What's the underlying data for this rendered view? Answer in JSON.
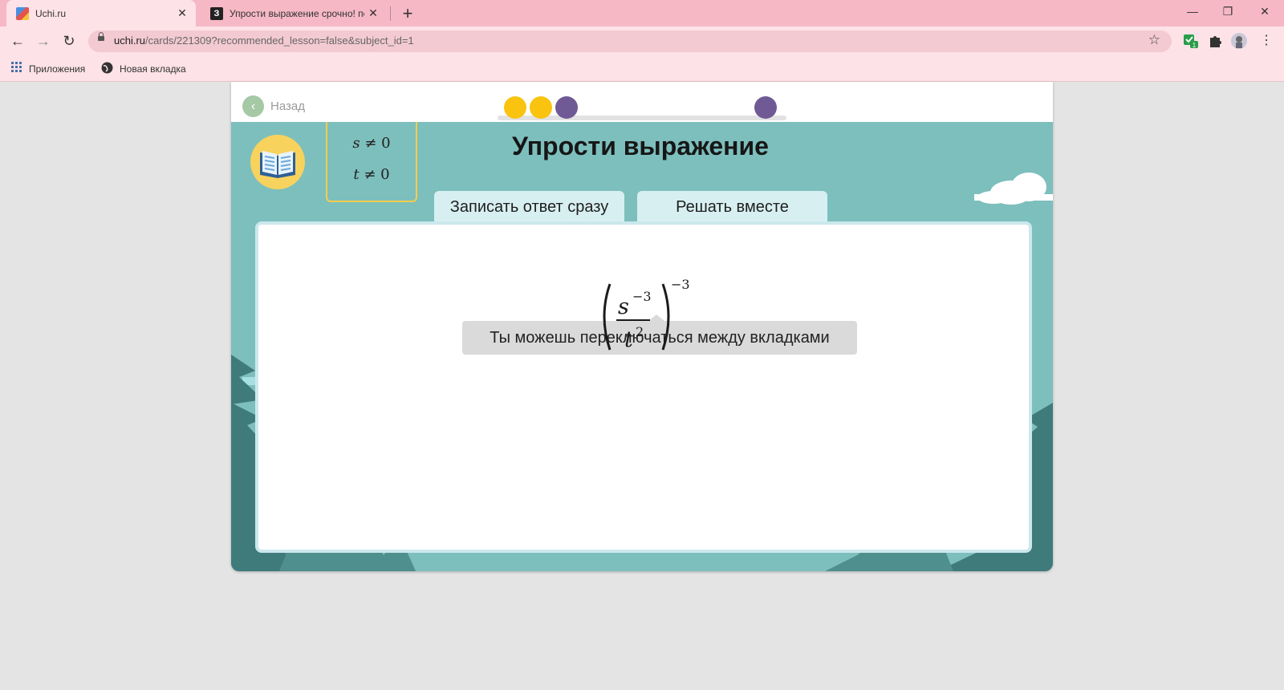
{
  "browser": {
    "tabs": [
      {
        "title": "Uchi.ru",
        "active": true
      },
      {
        "title": "Упрости выражение срочно! пс",
        "active": false
      }
    ],
    "url_host": "uchi.ru",
    "url_path": "/cards/221309?recommended_lesson=false&subject_id=1",
    "bookmarks": [
      {
        "label": "Приложения",
        "icon": "apps-grid-icon"
      },
      {
        "label": "Новая вкладка",
        "icon": "globe-icon"
      }
    ],
    "extension_badge": "1",
    "colors": {
      "tabbar": "#f7b8c6",
      "toolbar": "#fde2e7"
    }
  },
  "page": {
    "back_label": "Назад",
    "progress": {
      "steps": [
        "done",
        "done",
        "current",
        "current"
      ],
      "colors": {
        "done": "#f9c310",
        "current": "#6f5a96"
      }
    },
    "title": "Упрости выражение",
    "conditions": [
      {
        "var": "s",
        "rel": "≠",
        "val": "0"
      },
      {
        "var": "t",
        "rel": "≠",
        "val": "0"
      }
    ],
    "tabs": [
      {
        "label": "Записать ответ сразу"
      },
      {
        "label": "Решать вместе"
      }
    ],
    "tooltip": "Ты можешь переключаться между вкладками",
    "expression": {
      "numerator_base": "s",
      "numerator_exp": "−3",
      "denominator_base": "t",
      "denominator_exp": "2",
      "outer_exp": "−3"
    },
    "colors": {
      "scene_bg": "#7dbfbd",
      "tree_dark": "#3f7b7a",
      "tree_mid": "#4f8f8e",
      "cloud": "#a6dfe4"
    }
  }
}
